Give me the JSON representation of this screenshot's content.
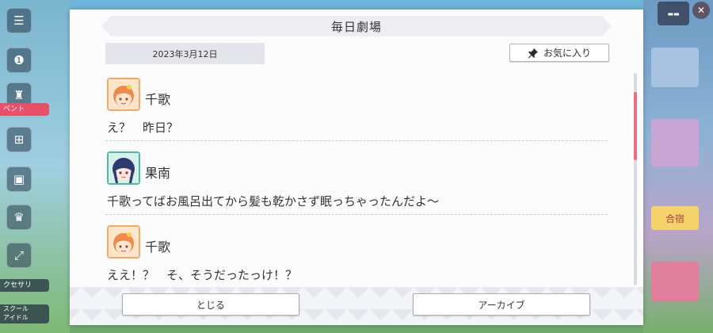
{
  "title": "毎日劇場",
  "date": "2023年3月12日",
  "favorite_label": "お気に入り",
  "entries": [
    {
      "speaker": "千歌",
      "line": "え？　昨日？",
      "avatar": "chika"
    },
    {
      "speaker": "果南",
      "line": "千歌ってばお風呂出てから髪も乾かさず眠っちゃったんだよ～",
      "avatar": "kanan"
    },
    {
      "speaker": "千歌",
      "line": "ええ！？　そ、そうだったっけ！？",
      "avatar": "chika"
    }
  ],
  "scroll_position": 0.12,
  "buttons": {
    "close": "とじる",
    "archive": "アーカイブ"
  },
  "background": {
    "side_tags": [
      "ベント",
      "クセサリ",
      "スクール\nアイドル"
    ],
    "right_label": "合宿"
  },
  "colors": {
    "accent": "#ee6f83",
    "chika_hair": "#f08a4b",
    "kanan_hair": "#2f3a73"
  }
}
